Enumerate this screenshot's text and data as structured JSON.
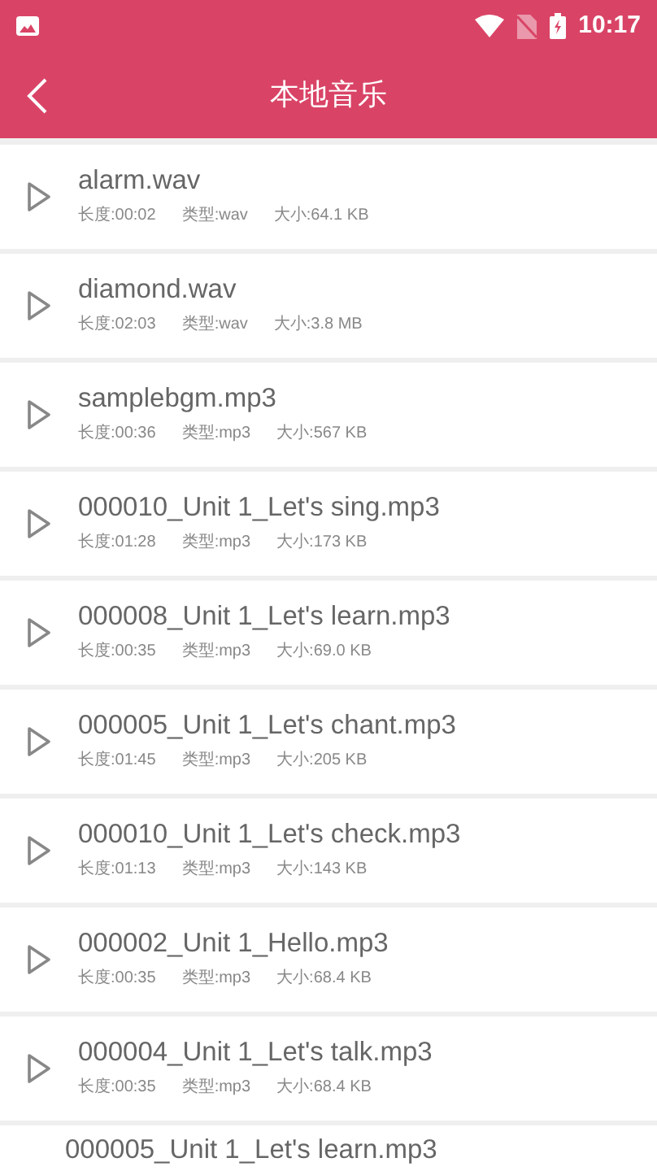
{
  "status_bar": {
    "time": "10:17"
  },
  "header": {
    "title": "本地音乐"
  },
  "files": [
    {
      "name": "alarm.wav",
      "duration": "长度:00:02",
      "type": "类型:wav",
      "size": "大小:64.1 KB"
    },
    {
      "name": "diamond.wav",
      "duration": "长度:02:03",
      "type": "类型:wav",
      "size": "大小:3.8 MB"
    },
    {
      "name": "samplebgm.mp3",
      "duration": "长度:00:36",
      "type": "类型:mp3",
      "size": "大小:567 KB"
    },
    {
      "name": "000010_Unit 1_Let's sing.mp3",
      "duration": "长度:01:28",
      "type": "类型:mp3",
      "size": "大小:173 KB"
    },
    {
      "name": "000008_Unit 1_Let's learn.mp3",
      "duration": "长度:00:35",
      "type": "类型:mp3",
      "size": "大小:69.0 KB"
    },
    {
      "name": "000005_Unit 1_Let's chant.mp3",
      "duration": "长度:01:45",
      "type": "类型:mp3",
      "size": "大小:205 KB"
    },
    {
      "name": "000010_Unit 1_Let's check.mp3",
      "duration": "长度:01:13",
      "type": "类型:mp3",
      "size": "大小:143 KB"
    },
    {
      "name": "000002_Unit 1_Hello.mp3",
      "duration": "长度:00:35",
      "type": "类型:mp3",
      "size": "大小:68.4 KB"
    },
    {
      "name": "000004_Unit 1_Let's talk.mp3",
      "duration": "长度:00:35",
      "type": "类型:mp3",
      "size": "大小:68.4 KB"
    },
    {
      "name": "000005_Unit 1_Let's learn.mp3"
    }
  ]
}
